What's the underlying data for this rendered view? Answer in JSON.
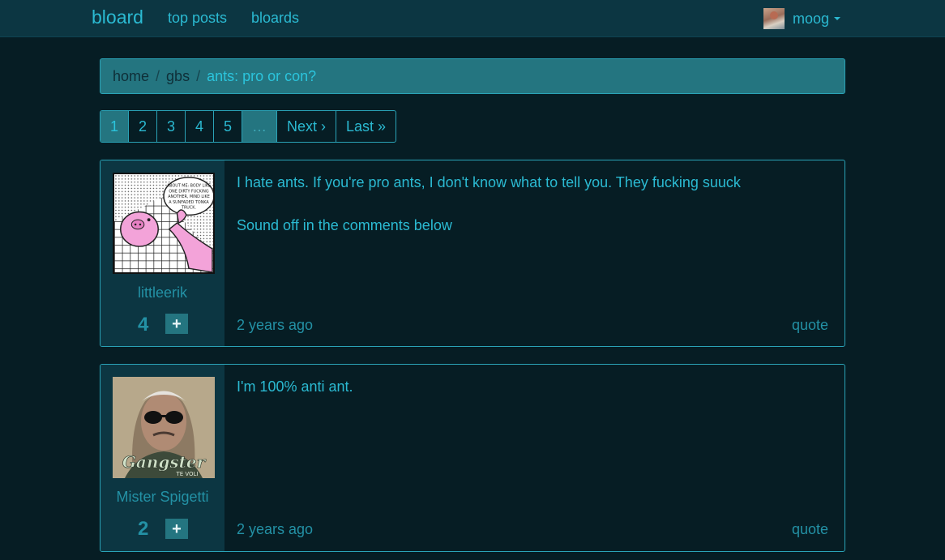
{
  "navbar": {
    "brand": "bloard",
    "links": [
      "top posts",
      "bloards"
    ],
    "user": "moog"
  },
  "breadcrumb": {
    "items": [
      "home",
      "gbs"
    ],
    "active": "ants: pro or con?",
    "separator": "/"
  },
  "pagination": {
    "pages": [
      "1",
      "2",
      "3",
      "4",
      "5",
      "…",
      "Next ›",
      "Last »"
    ],
    "active": "1"
  },
  "posts": [
    {
      "author": "littleerik",
      "score": "4",
      "vote_label": "+",
      "paragraphs": [
        "I hate ants. If you're pro ants, I don't know what to tell you. They fucking suuck",
        "Sound off in the comments below"
      ],
      "time": "2 years ago",
      "quote": "quote",
      "avatar_text": "ABOUT ME: BODY LIKE ONE DIRTY FUCKING ANOTHER, MIND LIKE A SUNFADED TONKA TRUCK."
    },
    {
      "author": "Mister Spigetti",
      "score": "2",
      "vote_label": "+",
      "paragraphs": [
        "I'm 100% anti ant."
      ],
      "time": "2 years ago",
      "quote": "quote",
      "avatar_text": "Gangster",
      "avatar_subtext": "TE VOLI"
    }
  ],
  "colors": {
    "background": "#061d24",
    "navbar": "#0c3642",
    "accent": "#2bbad2",
    "active": "#247580"
  }
}
